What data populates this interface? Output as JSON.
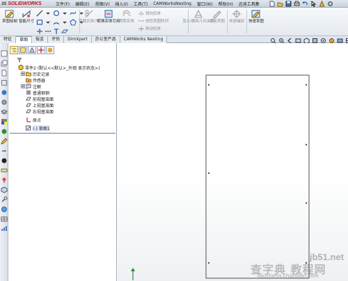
{
  "app": {
    "logo_text": "SOLIDWORKS",
    "logo_prefix": "3S"
  },
  "menu": {
    "items": [
      "文件(F)",
      "编辑(E)",
      "视图(V)",
      "插入(I)",
      "工具(T)",
      "CAMWorksNesting",
      "窗口(W)",
      "帮助(H)",
      "迈迪工具集"
    ]
  },
  "ribbon": {
    "exit_sketch": "草图绘制",
    "smart_dimension": "智能尺寸",
    "trim_entities": "剪裁实体(T)",
    "convert_entities": "转换实体引用",
    "offset_entities": "等距实体",
    "mirror_entities": "镜向实体",
    "linear_pattern": "线性草图阵列",
    "move_entities": "移动实体",
    "display_relations": "显示/删除几何关系",
    "repair_sketch": "修复草图",
    "quick_snaps": "快速捕捉",
    "rapid_sketch": "快速草图"
  },
  "tabs": {
    "items": [
      "特征",
      "草图",
      "钣金",
      "评估",
      "DimXpert",
      "办公室产品",
      "CAMWorks Nesting"
    ],
    "active_index": 1
  },
  "feature_tree": {
    "root": "零件2 (默认<<默认>_外观 显示状态>)",
    "items": [
      {
        "label": "历史记录",
        "expandable": true
      },
      {
        "label": "传感器",
        "expandable": false
      },
      {
        "label": "注解",
        "expandable": true
      },
      {
        "label": "普通钢钢",
        "expandable": false
      },
      {
        "label": "前视基准面",
        "expandable": false
      },
      {
        "label": "上视基准面",
        "expandable": false
      },
      {
        "label": "右视基准面",
        "expandable": false
      },
      {
        "label": "原点",
        "expandable": false
      },
      {
        "label": "(-) 草图1",
        "expandable": false
      }
    ]
  },
  "watermark": {
    "site": "jb51.net",
    "cn": "查字典 教程网",
    "url": "jiaocheng.chazidian.com"
  },
  "colors": {
    "accent": "#2a5da8",
    "sketch_line": "#3c3c3c",
    "logo_red": "#b11111"
  }
}
